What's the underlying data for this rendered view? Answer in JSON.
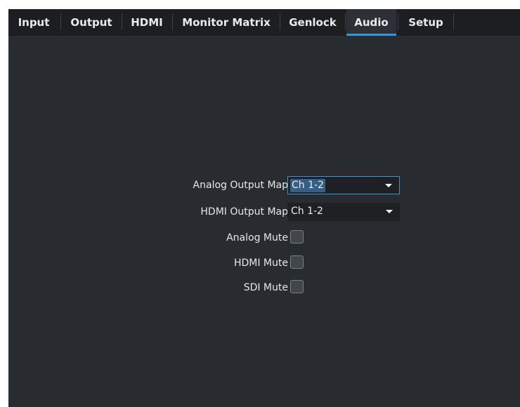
{
  "tabs": [
    {
      "label": "Input"
    },
    {
      "label": "Output"
    },
    {
      "label": "HDMI"
    },
    {
      "label": "Monitor Matrix"
    },
    {
      "label": "Genlock"
    },
    {
      "label": "Audio",
      "active": true
    },
    {
      "label": "Setup"
    }
  ],
  "audio": {
    "analog_output_map": {
      "label": "Analog Output Map",
      "value": "Ch 1-2"
    },
    "hdmi_output_map": {
      "label": "HDMI Output Map",
      "value": "Ch 1-2"
    },
    "analog_mute": {
      "label": "Analog Mute",
      "checked": false
    },
    "hdmi_mute": {
      "label": "HDMI Mute",
      "checked": false
    },
    "sdi_mute": {
      "label": "SDI Mute",
      "checked": false
    }
  },
  "colors": {
    "background": "#282b30",
    "tabbar": "#1c1e22",
    "accent": "#3a95d5"
  }
}
